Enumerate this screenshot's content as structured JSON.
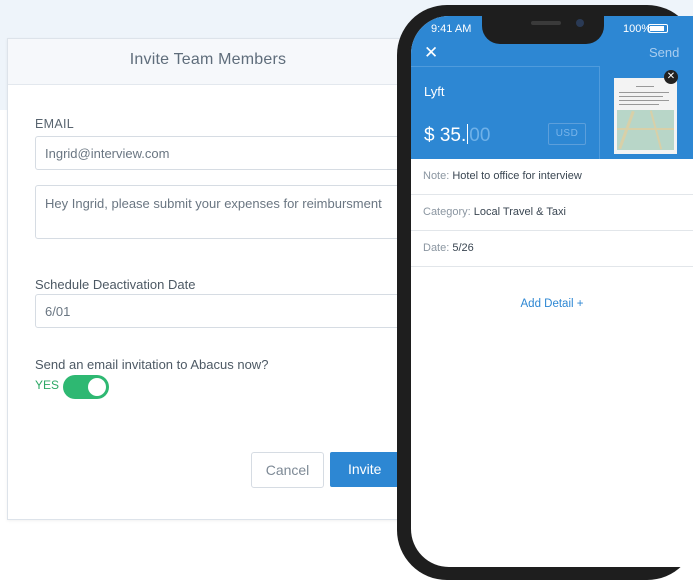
{
  "modal": {
    "title": "Invite Team Members",
    "email_label": "EMAIL",
    "email_value": "Ingrid@interview.com",
    "message_value": "Hey Ingrid, please submit your expenses for reimbursment",
    "deactivation_label": "Schedule Deactivation Date",
    "deactivation_value": "6/01",
    "invite_question": "Send an email invitation to Abacus now?",
    "toggle_label": "YES",
    "cancel_label": "Cancel",
    "invite_label": "Invite"
  },
  "phone": {
    "status_time": "9:41 AM",
    "status_battery": "100%",
    "close_glyph": "✕",
    "send_label": "Send",
    "merchant": "Lyft",
    "amount_prefix": "$ 35.",
    "amount_ghost": "00",
    "currency": "USD",
    "note_key": "Note:",
    "note_value": "Hotel to office for interview",
    "category_key": "Category:",
    "category_value": "Local Travel & Taxi",
    "date_key": "Date:",
    "date_value": "5/26",
    "add_detail": "Add Detail +",
    "receipt_close": "✕"
  },
  "colors": {
    "accent": "#2d87d3",
    "toggle": "#2eb872",
    "phone_frame": "#1e1e1e"
  },
  "icons": [
    "close-icon",
    "battery-icon",
    "toggle-switch"
  ]
}
